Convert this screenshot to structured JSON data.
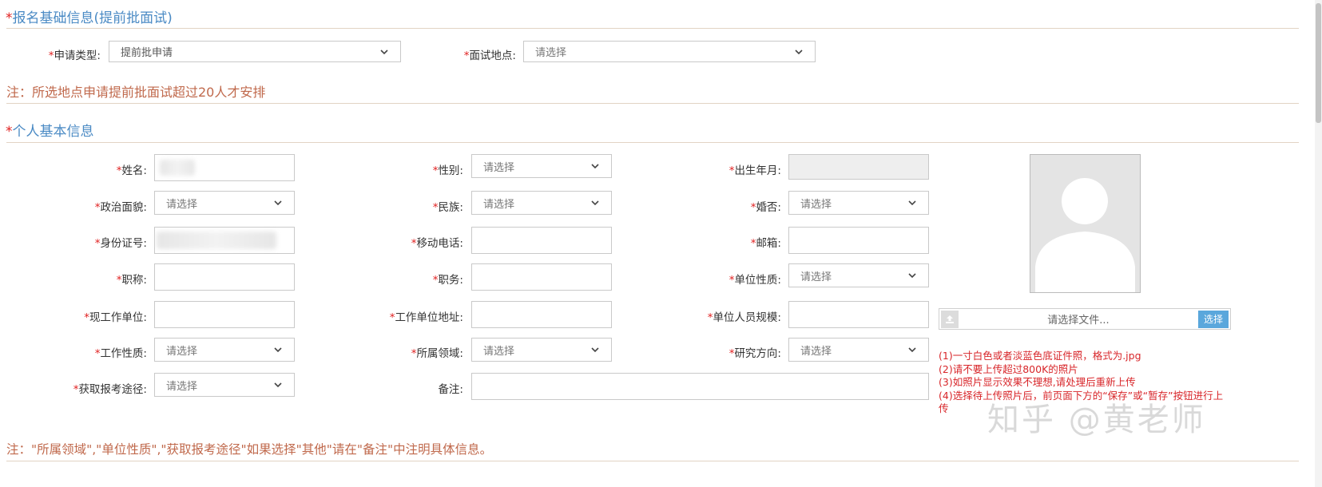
{
  "sections": {
    "basic_title": "报名基础信息(提前批面试)",
    "personal_title": "个人基本信息"
  },
  "application": {
    "type_label": "申请类型:",
    "type_value": "提前批申请",
    "location_label": "面试地点:",
    "location_value": "请选择"
  },
  "notes": {
    "location_note": "注：所选地点申请提前批面试超过20人才安排",
    "bottom_note": "注：\"所属领域\",\"单位性质\",\"获取报考途径\"如果选择\"其他\"请在\"备注\"中注明具体信息。"
  },
  "personal": {
    "name_label": "姓名:",
    "gender_label": "性别:",
    "gender_value": "请选择",
    "birth_label": "出生年月:",
    "politics_label": "政治面貌:",
    "politics_value": "请选择",
    "ethnicity_label": "民族:",
    "ethnicity_value": "请选择",
    "marital_label": "婚否:",
    "marital_value": "请选择",
    "id_label": "身份证号:",
    "mobile_label": "移动电话:",
    "email_label": "邮箱:",
    "title_label": "职称:",
    "position_label": "职务:",
    "org_type_label": "单位性质:",
    "org_type_value": "请选择",
    "employer_label": "现工作单位:",
    "employer_addr_label": "工作单位地址:",
    "org_size_label": "单位人员规模:",
    "work_nature_label": "工作性质:",
    "work_nature_value": "请选择",
    "field_label": "所属领域:",
    "field_value": "请选择",
    "research_label": "研究方向:",
    "research_value": "请选择",
    "source_label": "获取报考途径:",
    "source_value": "请选择",
    "remark_label": "备注:"
  },
  "photo": {
    "file_placeholder": "请选择文件...",
    "choose_button": "选择",
    "tips": [
      "(1)一寸白色或者淡蓝色底证件照，格式为.jpg",
      "(2)请不要上传超过800K的照片",
      "(3)如照片显示效果不理想,请处理后重新上传",
      "(4)选择待上传照片后，前页面下方的“保存”或“暂存”按钮进行上传"
    ]
  },
  "watermark": "知乎 @黄老师",
  "colors": {
    "required": "#e02020",
    "section_title": "#4a8ac4",
    "note": "#c0694c",
    "tips": "#d8262a",
    "button": "#5aa7dc"
  }
}
